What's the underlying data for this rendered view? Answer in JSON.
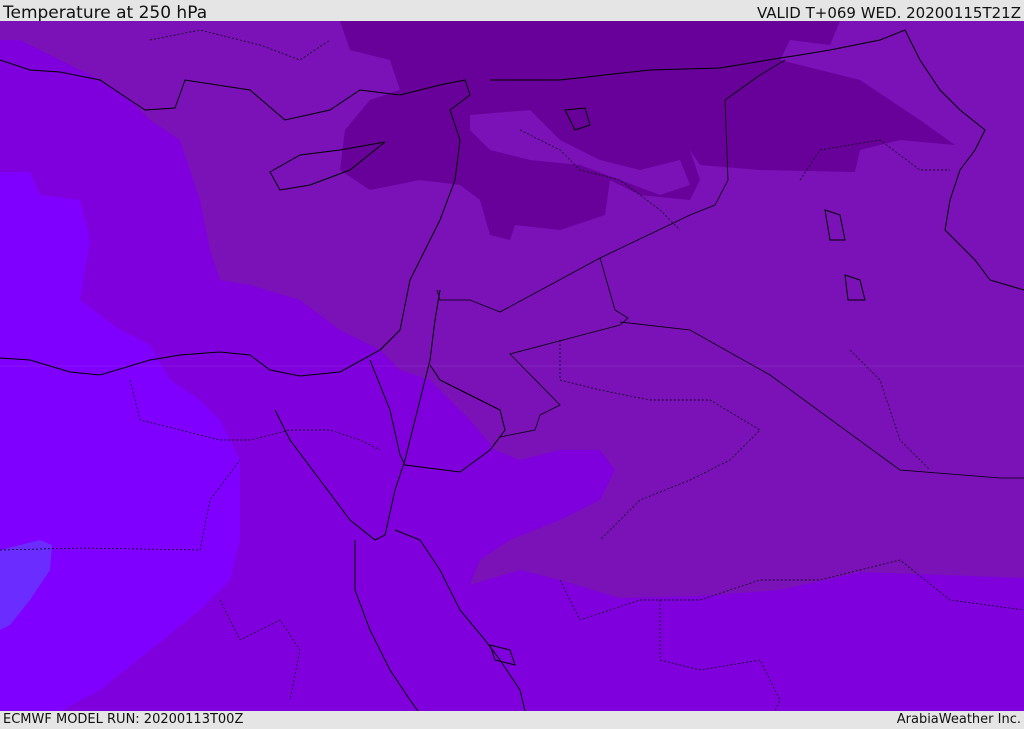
{
  "header": {
    "title": "Temperature at 250 hPa",
    "valid": "VALID T+069 WED. 20200115T21Z"
  },
  "footer": {
    "model_run": "ECMWF MODEL RUN: 20200113T00Z",
    "credit": "ArabiaWeather Inc."
  },
  "colors": {
    "warmest": "#6a2cff",
    "warm": "#8000ff",
    "base": "#7f00dd",
    "cool": "#7a12b8",
    "coldest": "#68009a",
    "border": "#000000"
  }
}
